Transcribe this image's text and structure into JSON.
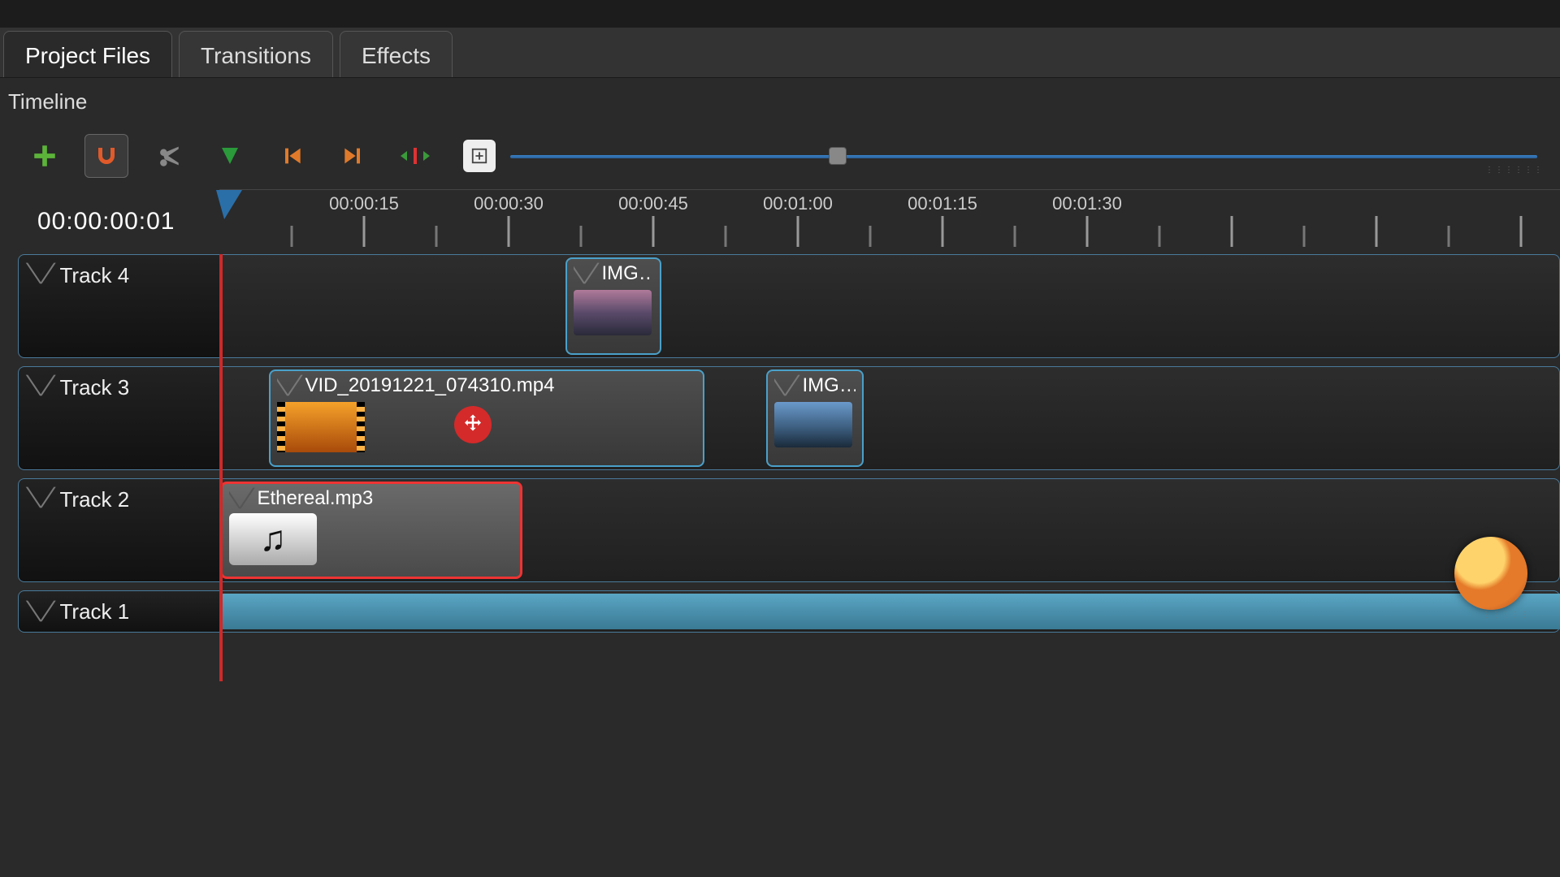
{
  "tabs": [
    {
      "label": "Project Files",
      "active": true
    },
    {
      "label": "Transitions",
      "active": false
    },
    {
      "label": "Effects",
      "active": false
    }
  ],
  "panel_title": "Timeline",
  "toolbar": {
    "add": "+",
    "snap": "⊃",
    "cut": "✂",
    "marker": "▼",
    "prev": "⏮",
    "next": "⏭",
    "center": "⇢⇠",
    "zoom_plus": "+"
  },
  "time_readout": "00:00:00:01",
  "ruler_labels": [
    "00:00:15",
    "00:00:30",
    "00:00:45",
    "00:01:00",
    "00:01:15",
    "00:01:30"
  ],
  "tracks": [
    {
      "name": "Track 4"
    },
    {
      "name": "Track 3"
    },
    {
      "name": "Track 2"
    },
    {
      "name": "Track 1"
    }
  ],
  "clips": {
    "track4_img": {
      "label": "IMG…"
    },
    "track3_vid": {
      "label": "VID_20191221_074310.mp4"
    },
    "track3_img": {
      "label": "IMG…"
    },
    "track2_audio": {
      "label": "Ethereal.mp3"
    }
  }
}
